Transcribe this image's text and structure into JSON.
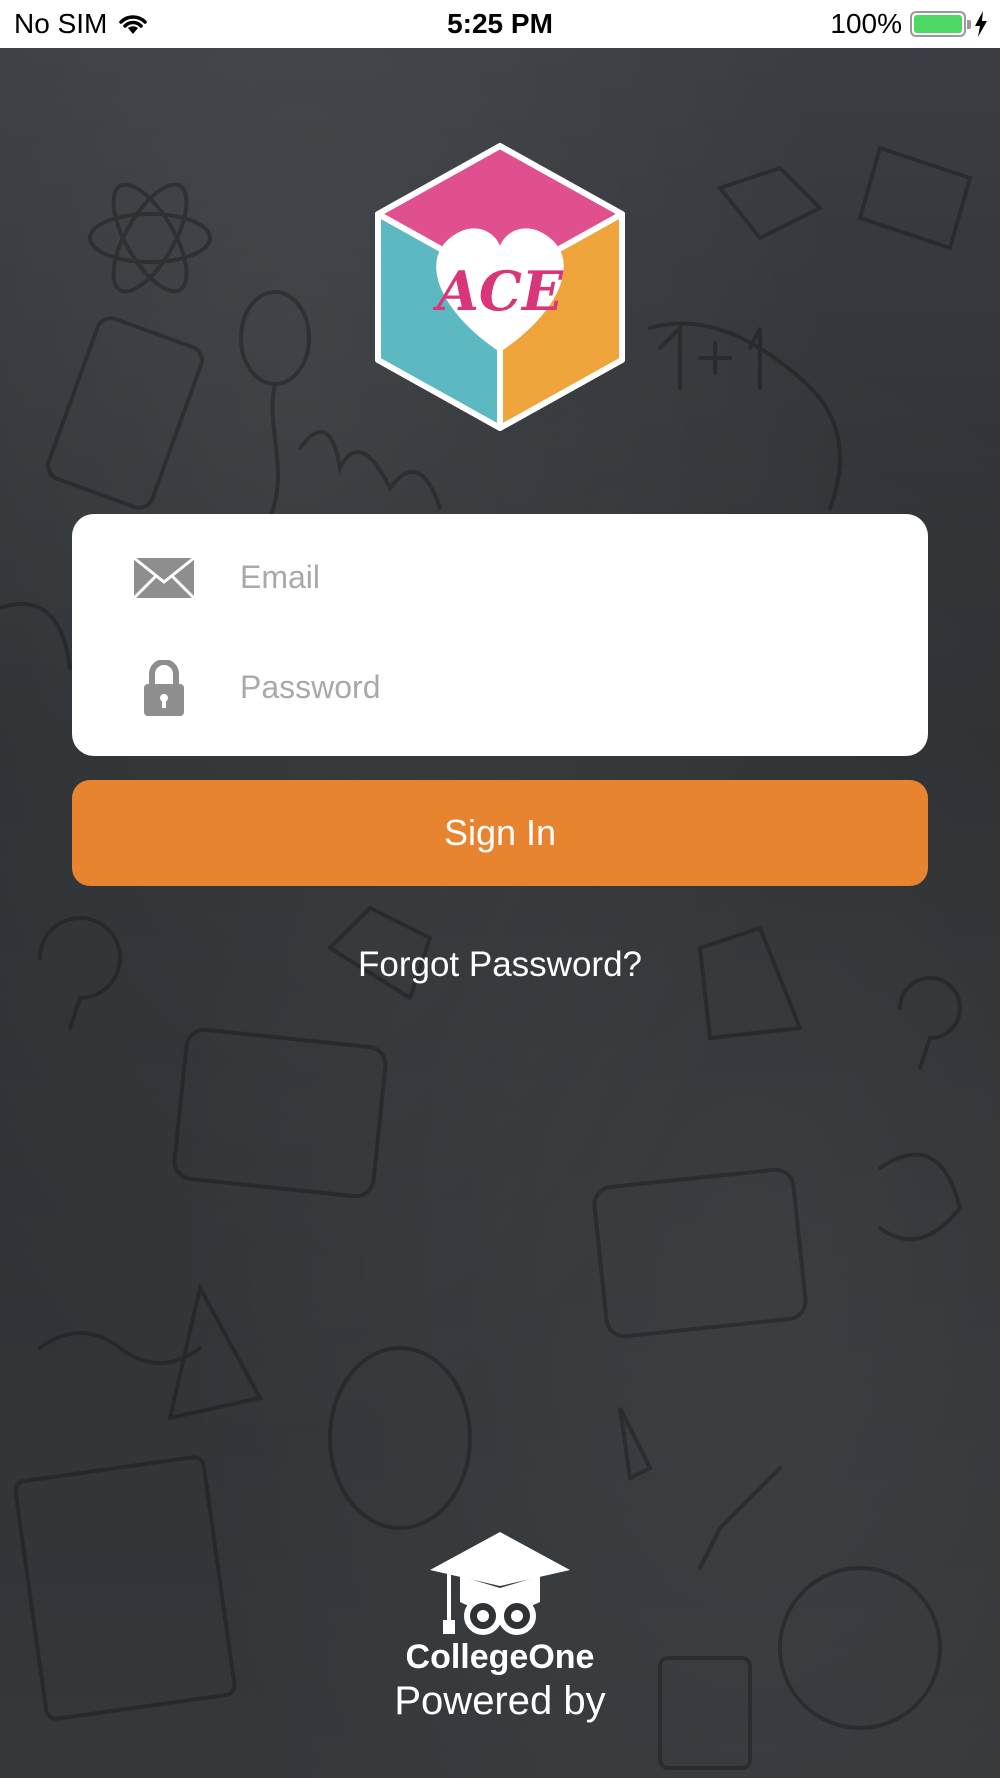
{
  "status_bar": {
    "carrier": "No SIM",
    "time": "5:25 PM",
    "battery": "100%"
  },
  "login": {
    "email_placeholder": "Email",
    "password_placeholder": "Password",
    "sign_in_label": "Sign In",
    "forgot_password_label": "Forgot Password?"
  },
  "footer": {
    "brand_name": "CollegeOne",
    "powered_by": "Powered by"
  },
  "logo": {
    "text": "ACE"
  },
  "colors": {
    "accent": "#e88330",
    "background": "#2e3235",
    "card": "#ffffff"
  }
}
